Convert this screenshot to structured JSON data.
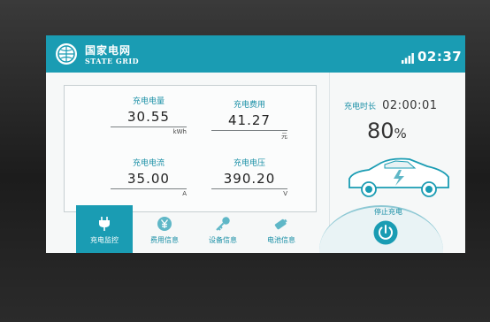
{
  "header": {
    "logo_cn": "国家电网",
    "logo_en": "STATE GRID",
    "time": "02:37"
  },
  "metrics": [
    {
      "label": "充电电量",
      "value": "30.55",
      "unit": "kWh"
    },
    {
      "label": "充电费用",
      "value": "41.27",
      "unit": "元"
    },
    {
      "label": "充电电流",
      "value": "35.00",
      "unit": "A"
    },
    {
      "label": "充电电压",
      "value": "390.20",
      "unit": "V"
    }
  ],
  "tabs": [
    {
      "label": "充电监控",
      "icon": "plug-icon",
      "active": true
    },
    {
      "label": "费用信息",
      "icon": "yen-coin-icon",
      "active": false
    },
    {
      "label": "设备信息",
      "icon": "key-icon",
      "active": false
    },
    {
      "label": "电池信息",
      "icon": "battery-icon",
      "active": false
    }
  ],
  "status": {
    "duration_label": "充电时长",
    "duration_value": "02:00:01",
    "percent": "80",
    "percent_unit": "%"
  },
  "stop": {
    "label": "停止充电"
  },
  "colors": {
    "accent": "#1a9cb3",
    "label_text": "#1a8fa6"
  }
}
